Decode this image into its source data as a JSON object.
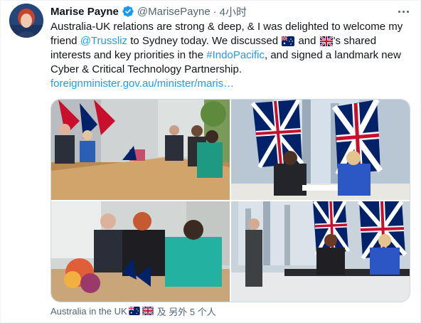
{
  "tweet": {
    "author_name": "Marise Payne",
    "handle": "@MarisePayne",
    "separator": "·",
    "time": "4小时",
    "text_part1": "Australia-UK relations are strong & deep, & I was delighted to welcome my friend ",
    "mention": "@Trussliz",
    "text_part2": " to Sydney today. We discussed ",
    "text_and": " and ",
    "text_part3": "'s shared interests and key priorities in the ",
    "hashtag": "#IndoPacific",
    "text_part4": ", and signed a landmark new Cyber & Critical Technology Partnership.",
    "url": "foreignminister.gov.au/minister/maris…",
    "footer_tag_text": "Australia in the UK",
    "footer_more": "及 另外 5 个人"
  },
  "icons": {
    "verified": "verified-badge-icon",
    "more": "more-dots-icon",
    "au_flag": "australia-flag-emoji",
    "uk_flag": "uk-flag-emoji"
  },
  "colors": {
    "link": "#1d9bf0",
    "secondary_text": "#536471"
  }
}
